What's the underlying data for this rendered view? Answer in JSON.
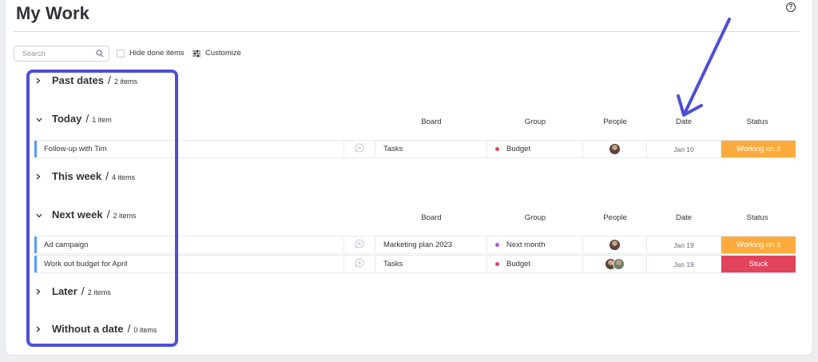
{
  "page": {
    "title": "My Work",
    "help_icon": "?"
  },
  "toolbar": {
    "search_placeholder": "Search",
    "hide_done_label": "Hide done items",
    "customize_label": "Customize"
  },
  "columns": {
    "board": "Board",
    "group": "Group",
    "people": "People",
    "date": "Date",
    "status": "Status"
  },
  "groups": [
    {
      "name": "Past dates",
      "sep": "/",
      "count": "2 items",
      "expanded": false,
      "items": []
    },
    {
      "name": "Today",
      "sep": "/",
      "count": "1 item",
      "expanded": true,
      "items": [
        {
          "name": "Follow-up with Tim",
          "board": "Tasks",
          "group": "Budget",
          "group_color": "#e2445c",
          "people": 1,
          "date": "Jan 10",
          "status": "Working on it",
          "status_color": "#fdab3d"
        }
      ]
    },
    {
      "name": "This week",
      "sep": "/",
      "count": "4 items",
      "expanded": false,
      "items": []
    },
    {
      "name": "Next week",
      "sep": "/",
      "count": "2 items",
      "expanded": true,
      "items": [
        {
          "name": "Ad campaign",
          "board": "Marketing plan 2023",
          "group": "Next month",
          "group_color": "#a25ddc",
          "people": 1,
          "date": "Jan 19",
          "status": "Working on it",
          "status_color": "#fdab3d"
        },
        {
          "name": "Work out budget for April",
          "board": "Tasks",
          "group": "Budget",
          "group_color": "#e2445c",
          "people": 2,
          "date": "Jan 19",
          "status": "Stuck",
          "status_color": "#e2445c"
        }
      ]
    },
    {
      "name": "Later",
      "sep": "/",
      "count": "2 items",
      "expanded": false,
      "items": []
    },
    {
      "name": "Without a date",
      "sep": "/",
      "count": "0 items",
      "expanded": false,
      "items": []
    }
  ],
  "colors": {
    "accent_annotation": "#4d4fd6",
    "row_bar": "#579bfc"
  },
  "icons": {
    "search": "search-icon",
    "customize": "sliders-icon",
    "update": "add-update-icon",
    "help": "question-circle-icon"
  }
}
